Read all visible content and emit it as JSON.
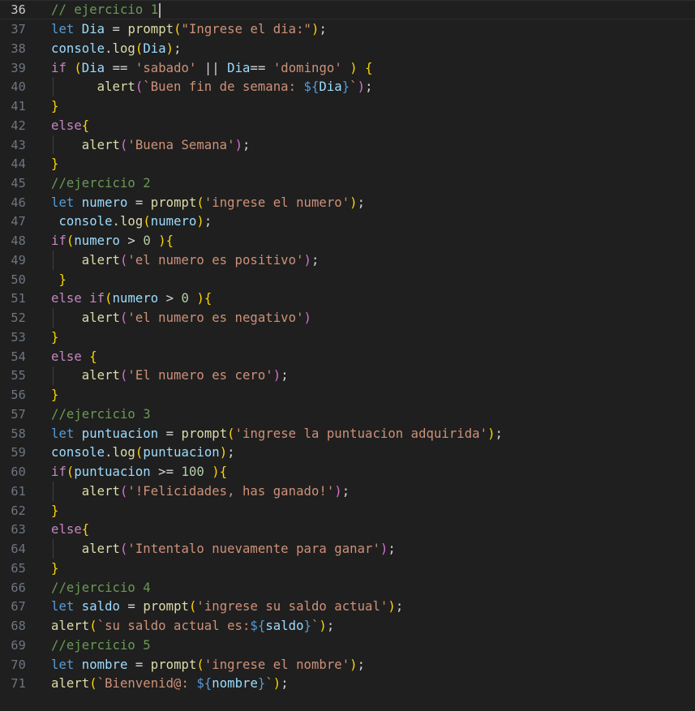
{
  "editor": {
    "current_line": 36,
    "colors": {
      "background": "#1f1f1f",
      "comment": "#6a9955",
      "keyword": "#569cd6",
      "control": "#c586c0",
      "variable": "#9cdcfe",
      "function": "#dcdcaa",
      "string": "#ce9178",
      "number": "#b5cea8",
      "bracket1": "#ffd700",
      "bracket2": "#da70d6",
      "bracket3": "#179fff"
    },
    "lines": [
      {
        "n": 36,
        "tokens": [
          [
            "cm",
            "// ejercicio 1"
          ]
        ]
      },
      {
        "n": 37,
        "tokens": [
          [
            "kw",
            "let"
          ],
          [
            "pl",
            " "
          ],
          [
            "var",
            "Dia"
          ],
          [
            "op",
            " = "
          ],
          [
            "fn",
            "prompt"
          ],
          [
            "b1",
            "("
          ],
          [
            "str",
            "\"Ingrese el dia:\""
          ],
          [
            "b1",
            ")"
          ],
          [
            "op",
            ";"
          ]
        ]
      },
      {
        "n": 38,
        "tokens": [
          [
            "var",
            "console"
          ],
          [
            "op",
            "."
          ],
          [
            "fn",
            "log"
          ],
          [
            "b1",
            "("
          ],
          [
            "var",
            "Dia"
          ],
          [
            "b1",
            ")"
          ],
          [
            "op",
            ";"
          ]
        ]
      },
      {
        "n": 39,
        "tokens": [
          [
            "ctl",
            "if"
          ],
          [
            "pl",
            " "
          ],
          [
            "b1",
            "("
          ],
          [
            "var",
            "Dia"
          ],
          [
            "op",
            " == "
          ],
          [
            "str",
            "'sabado'"
          ],
          [
            "op",
            " || "
          ],
          [
            "var",
            "Dia"
          ],
          [
            "op",
            "== "
          ],
          [
            "str",
            "'domingo'"
          ],
          [
            "pl",
            " "
          ],
          [
            "b1",
            ")"
          ],
          [
            "pl",
            " "
          ],
          [
            "b1",
            "{"
          ]
        ]
      },
      {
        "n": 40,
        "tokens": [
          [
            "pl",
            "      "
          ],
          [
            "fn",
            "alert"
          ],
          [
            "b2",
            "("
          ],
          [
            "str",
            "`Buen fin de semana: "
          ],
          [
            "tpl",
            "${"
          ],
          [
            "var",
            "Dia"
          ],
          [
            "tpl",
            "}"
          ],
          [
            "str",
            "`"
          ],
          [
            "b2",
            ")"
          ],
          [
            "op",
            ";"
          ]
        ]
      },
      {
        "n": 41,
        "tokens": [
          [
            "b1",
            "}"
          ]
        ]
      },
      {
        "n": 42,
        "tokens": [
          [
            "ctl",
            "else"
          ],
          [
            "b1",
            "{"
          ]
        ]
      },
      {
        "n": 43,
        "tokens": [
          [
            "pl",
            "    "
          ],
          [
            "fn",
            "alert"
          ],
          [
            "b2",
            "("
          ],
          [
            "str",
            "'Buena Semana'"
          ],
          [
            "b2",
            ")"
          ],
          [
            "op",
            ";"
          ]
        ]
      },
      {
        "n": 44,
        "tokens": [
          [
            "b1",
            "}"
          ]
        ]
      },
      {
        "n": 45,
        "tokens": [
          [
            "cm",
            "//ejercicio 2"
          ]
        ]
      },
      {
        "n": 46,
        "tokens": [
          [
            "kw",
            "let"
          ],
          [
            "pl",
            " "
          ],
          [
            "var",
            "numero"
          ],
          [
            "op",
            " = "
          ],
          [
            "fn",
            "prompt"
          ],
          [
            "b1",
            "("
          ],
          [
            "str",
            "'ingrese el numero'"
          ],
          [
            "b1",
            ")"
          ],
          [
            "op",
            ";"
          ]
        ]
      },
      {
        "n": 47,
        "tokens": [
          [
            "pl",
            " "
          ],
          [
            "var",
            "console"
          ],
          [
            "op",
            "."
          ],
          [
            "fn",
            "log"
          ],
          [
            "b1",
            "("
          ],
          [
            "var",
            "numero"
          ],
          [
            "b1",
            ")"
          ],
          [
            "op",
            ";"
          ]
        ]
      },
      {
        "n": 48,
        "tokens": [
          [
            "ctl",
            "if"
          ],
          [
            "b1",
            "("
          ],
          [
            "var",
            "numero"
          ],
          [
            "op",
            " > "
          ],
          [
            "num",
            "0"
          ],
          [
            "pl",
            " "
          ],
          [
            "b1",
            ")"
          ],
          [
            "b1",
            "{"
          ]
        ]
      },
      {
        "n": 49,
        "tokens": [
          [
            "pl",
            "    "
          ],
          [
            "fn",
            "alert"
          ],
          [
            "b2",
            "("
          ],
          [
            "str",
            "'el numero es positivo'"
          ],
          [
            "b2",
            ")"
          ],
          [
            "op",
            ";"
          ]
        ]
      },
      {
        "n": 50,
        "tokens": [
          [
            "pl",
            " "
          ],
          [
            "b1",
            "}"
          ]
        ]
      },
      {
        "n": 51,
        "tokens": [
          [
            "ctl",
            "else"
          ],
          [
            "pl",
            " "
          ],
          [
            "ctl",
            "if"
          ],
          [
            "b1",
            "("
          ],
          [
            "var",
            "numero"
          ],
          [
            "op",
            " > "
          ],
          [
            "num",
            "0"
          ],
          [
            "pl",
            " "
          ],
          [
            "b1",
            ")"
          ],
          [
            "b1",
            "{"
          ]
        ]
      },
      {
        "n": 52,
        "tokens": [
          [
            "pl",
            "    "
          ],
          [
            "fn",
            "alert"
          ],
          [
            "b2",
            "("
          ],
          [
            "str",
            "'el numero es negativo'"
          ],
          [
            "b2",
            ")"
          ]
        ]
      },
      {
        "n": 53,
        "tokens": [
          [
            "b1",
            "}"
          ]
        ]
      },
      {
        "n": 54,
        "tokens": [
          [
            "ctl",
            "else"
          ],
          [
            "pl",
            " "
          ],
          [
            "b1",
            "{"
          ]
        ]
      },
      {
        "n": 55,
        "tokens": [
          [
            "pl",
            "    "
          ],
          [
            "fn",
            "alert"
          ],
          [
            "b2",
            "("
          ],
          [
            "str",
            "'El numero es cero'"
          ],
          [
            "b2",
            ")"
          ],
          [
            "op",
            ";"
          ]
        ]
      },
      {
        "n": 56,
        "tokens": [
          [
            "b1",
            "}"
          ]
        ]
      },
      {
        "n": 57,
        "tokens": [
          [
            "cm",
            "//ejercicio 3"
          ]
        ]
      },
      {
        "n": 58,
        "tokens": [
          [
            "kw",
            "let"
          ],
          [
            "pl",
            " "
          ],
          [
            "var",
            "puntuacion"
          ],
          [
            "op",
            " = "
          ],
          [
            "fn",
            "prompt"
          ],
          [
            "b1",
            "("
          ],
          [
            "str",
            "'ingrese la puntuacion adquirida'"
          ],
          [
            "b1",
            ")"
          ],
          [
            "op",
            ";"
          ]
        ]
      },
      {
        "n": 59,
        "tokens": [
          [
            "var",
            "console"
          ],
          [
            "op",
            "."
          ],
          [
            "fn",
            "log"
          ],
          [
            "b1",
            "("
          ],
          [
            "var",
            "puntuacion"
          ],
          [
            "b1",
            ")"
          ],
          [
            "op",
            ";"
          ]
        ]
      },
      {
        "n": 60,
        "tokens": [
          [
            "ctl",
            "if"
          ],
          [
            "b1",
            "("
          ],
          [
            "var",
            "puntuacion"
          ],
          [
            "op",
            " >= "
          ],
          [
            "num",
            "100"
          ],
          [
            "pl",
            " "
          ],
          [
            "b1",
            ")"
          ],
          [
            "b1",
            "{"
          ]
        ]
      },
      {
        "n": 61,
        "tokens": [
          [
            "pl",
            "    "
          ],
          [
            "fn",
            "alert"
          ],
          [
            "b2",
            "("
          ],
          [
            "str",
            "'!Felicidades, has ganado!'"
          ],
          [
            "b2",
            ")"
          ],
          [
            "op",
            ";"
          ]
        ]
      },
      {
        "n": 62,
        "tokens": [
          [
            "b1",
            "}"
          ]
        ]
      },
      {
        "n": 63,
        "tokens": [
          [
            "ctl",
            "else"
          ],
          [
            "b1",
            "{"
          ]
        ]
      },
      {
        "n": 64,
        "tokens": [
          [
            "pl",
            "    "
          ],
          [
            "fn",
            "alert"
          ],
          [
            "b2",
            "("
          ],
          [
            "str",
            "'Intentalo nuevamente para ganar'"
          ],
          [
            "b2",
            ")"
          ],
          [
            "op",
            ";"
          ]
        ]
      },
      {
        "n": 65,
        "tokens": [
          [
            "b1",
            "}"
          ]
        ]
      },
      {
        "n": 66,
        "tokens": [
          [
            "cm",
            "//ejercicio 4"
          ]
        ]
      },
      {
        "n": 67,
        "tokens": [
          [
            "kw",
            "let"
          ],
          [
            "pl",
            " "
          ],
          [
            "var",
            "saldo"
          ],
          [
            "op",
            " = "
          ],
          [
            "fn",
            "prompt"
          ],
          [
            "b1",
            "("
          ],
          [
            "str",
            "'ingrese su saldo actual'"
          ],
          [
            "b1",
            ")"
          ],
          [
            "op",
            ";"
          ]
        ]
      },
      {
        "n": 68,
        "tokens": [
          [
            "fn",
            "alert"
          ],
          [
            "b1",
            "("
          ],
          [
            "str",
            "`su saldo actual es:"
          ],
          [
            "tpl",
            "${"
          ],
          [
            "var",
            "saldo"
          ],
          [
            "tpl",
            "}"
          ],
          [
            "str",
            "`"
          ],
          [
            "b1",
            ")"
          ],
          [
            "op",
            ";"
          ]
        ]
      },
      {
        "n": 69,
        "tokens": [
          [
            "cm",
            "//ejercicio 5"
          ]
        ]
      },
      {
        "n": 70,
        "tokens": [
          [
            "kw",
            "let"
          ],
          [
            "pl",
            " "
          ],
          [
            "var",
            "nombre"
          ],
          [
            "op",
            " = "
          ],
          [
            "fn",
            "prompt"
          ],
          [
            "b1",
            "("
          ],
          [
            "str",
            "'ingrese el nombre'"
          ],
          [
            "b1",
            ")"
          ],
          [
            "op",
            ";"
          ]
        ]
      },
      {
        "n": 71,
        "tokens": [
          [
            "fn",
            "alert"
          ],
          [
            "b1",
            "("
          ],
          [
            "str",
            "`Bienvenid@: "
          ],
          [
            "tpl",
            "${"
          ],
          [
            "var",
            "nombre"
          ],
          [
            "tpl",
            "}"
          ],
          [
            "str",
            "`"
          ],
          [
            "b1",
            ")"
          ],
          [
            "op",
            ";"
          ]
        ]
      }
    ]
  }
}
